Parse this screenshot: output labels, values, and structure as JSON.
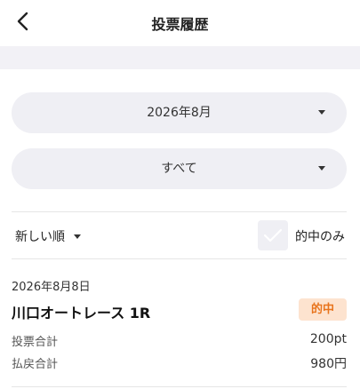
{
  "header": {
    "title": "投票履歴",
    "back_icon": "chevron-left-icon"
  },
  "filters": {
    "month": "2026年8月",
    "type": "すべて",
    "sort": "新しい順",
    "hit_only_label": "的中のみ",
    "hit_only_checked": false
  },
  "history": [
    {
      "date": "2026年8月8日",
      "race": "川口オートレース 1R",
      "status": "的中",
      "bet_label": "投票合計",
      "bet_value": "200pt",
      "payout_label": "払戻合計",
      "payout_value": "980円"
    }
  ],
  "colors": {
    "badge_bg": "#fde3cf",
    "badge_text": "#e8741d",
    "select_bg": "#efeff4"
  }
}
